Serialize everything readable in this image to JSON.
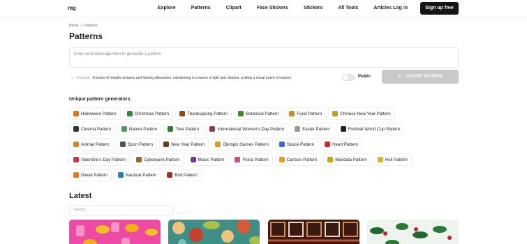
{
  "header": {
    "logo": "mg",
    "nav": [
      "Explore",
      "Patterns",
      "Clipart",
      "Face Stickers",
      "Stickers",
      "All Tools",
      "Articles"
    ],
    "login": "Log in",
    "signup": "Sign up free"
  },
  "breadcrumb": {
    "home": "Home",
    "separator": ">",
    "current": "Patterns"
  },
  "page_title": "Patterns",
  "prompt": {
    "placeholder": "Enter your message here to generate a pattern"
  },
  "example": {
    "label": "Example",
    "text": "A fusion of metallic textures and flowing silhouettes, intertwining in a dance of light and shadow, crafting a visual poem of modern"
  },
  "public_label": "Public",
  "public_toggle_on": false,
  "create_button": "CREATE PATTERN",
  "generators": {
    "title": "Unique pattern generators",
    "rows": [
      [
        {
          "label": "Halloween Pattern",
          "icon": "pumpkin-icon",
          "color": "#d9761c"
        },
        {
          "label": "Christmas Pattern",
          "icon": "christmas-tree-icon",
          "color": "#2f8a3a"
        },
        {
          "label": "Thanksgiving Pattern",
          "icon": "turkey-icon",
          "color": "#8a4a1c"
        },
        {
          "label": "Botanical Pattern",
          "icon": "leaf-icon",
          "color": "#3d8a2a"
        },
        {
          "label": "Food Pattern",
          "icon": "burger-icon",
          "color": "#c98a2a"
        },
        {
          "label": "Chinese New Year Pattern",
          "icon": "dragon-icon",
          "color": "#b8a020"
        }
      ],
      [
        {
          "label": "Cinema Pattern",
          "icon": "film-icon",
          "color": "#333333"
        },
        {
          "label": "Nature Pattern",
          "icon": "mountain-icon",
          "color": "#4a9a6a"
        },
        {
          "label": "Tree Pattern",
          "icon": "tree-icon",
          "color": "#2e7d32"
        },
        {
          "label": "International Women's Day Pattern",
          "icon": "women-day-icon",
          "color": "#8a3a5a"
        },
        {
          "label": "Easter Pattern",
          "icon": "egg-icon",
          "color": "#9a9a9a"
        },
        {
          "label": "Football World Cup Pattern",
          "icon": "soccer-ball-icon",
          "color": "#222222"
        }
      ],
      [
        {
          "label": "Animal Pattern",
          "icon": "tiger-icon",
          "color": "#d08a1c"
        },
        {
          "label": "Sport Pattern",
          "icon": "stadium-icon",
          "color": "#555555"
        },
        {
          "label": "New Year Pattern",
          "icon": "mask-icon",
          "color": "#6a3a1c"
        },
        {
          "label": "Olympic Games Pattern",
          "icon": "olympic-icon",
          "color": "#d0a020"
        },
        {
          "label": "Space Pattern",
          "icon": "rocket-icon",
          "color": "#3a6ad0"
        },
        {
          "label": "Heart Pattern",
          "icon": "heart-icon",
          "color": "#d02a2a"
        }
      ],
      [
        {
          "label": "Valentine's Day Pattern",
          "icon": "love-letter-icon",
          "color": "#d0304a"
        },
        {
          "label": "Cyberpunk Pattern",
          "icon": "cyberpunk-icon",
          "color": "#8a6a2a"
        },
        {
          "label": "Music Pattern",
          "icon": "music-icon",
          "color": "#6a3aa0"
        },
        {
          "label": "Floral Pattern",
          "icon": "flower-icon",
          "color": "#d04a8a"
        },
        {
          "label": "Cartoon Pattern",
          "icon": "pencil-icon",
          "color": "#e0a020"
        },
        {
          "label": "Mandala Pattern",
          "icon": "mandala-icon",
          "color": "#d0a010"
        },
        {
          "label": "Holi Pattern",
          "icon": "holi-icon",
          "color": "#e0b020"
        }
      ],
      [
        {
          "label": "Diwali Pattern",
          "icon": "diya-icon",
          "color": "#e07a1a"
        },
        {
          "label": "Nautical Pattern",
          "icon": "wave-icon",
          "color": "#2a7ac0"
        },
        {
          "label": "Bird Pattern",
          "icon": "bird-icon",
          "color": "#a0302a"
        }
      ]
    ]
  },
  "latest": {
    "title": "Latest",
    "search_placeholder": "Search"
  }
}
